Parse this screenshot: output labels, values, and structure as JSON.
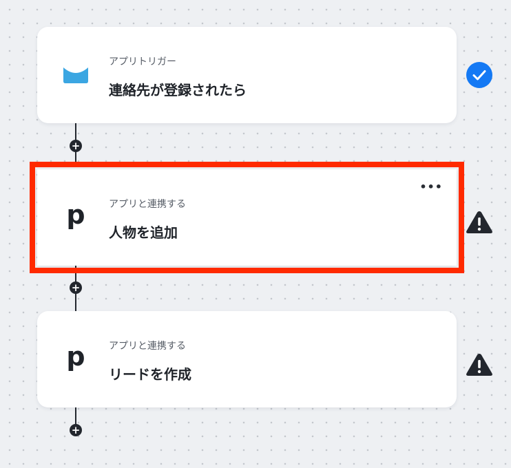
{
  "flow": {
    "steps": [
      {
        "subtitle": "アプリトリガー",
        "title": "連絡先が登録されたら",
        "icon": "getresponse-mail-icon",
        "status": "complete-check-icon"
      },
      {
        "subtitle": "アプリと連携する",
        "title": "人物を追加",
        "icon": "pipedrive-p-icon",
        "logo_text": "p",
        "more": "•••",
        "status": "warning-icon"
      },
      {
        "subtitle": "アプリと連携する",
        "title": "リードを作成",
        "icon": "pipedrive-p-icon",
        "logo_text": "p",
        "status": "warning-icon"
      }
    ],
    "add_symbol": "+"
  },
  "colors": {
    "highlight": "#ff2a00",
    "check_blue": "#1479f4",
    "mail_blue": "#3ba6e2",
    "dark": "#23272e"
  }
}
